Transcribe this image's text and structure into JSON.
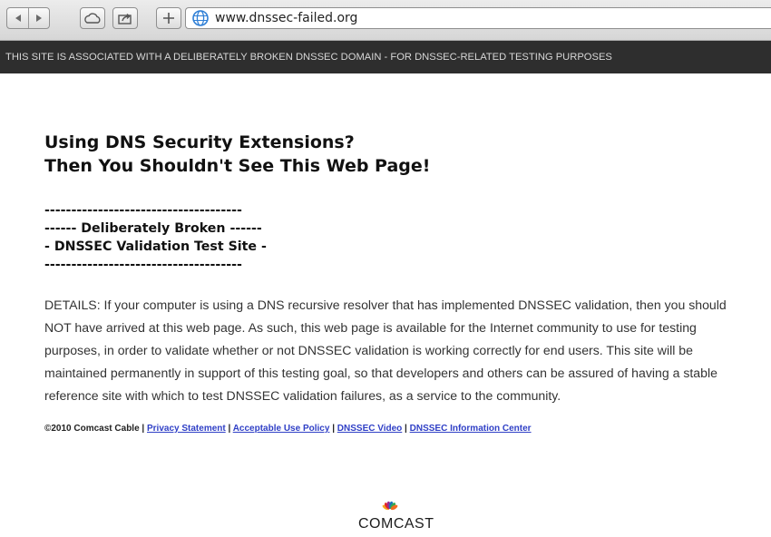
{
  "browser": {
    "url": "www.dnssec-failed.org",
    "icons": [
      "back-icon",
      "forward-icon",
      "cloud-icon",
      "share-icon",
      "add-tab-icon",
      "globe-icon"
    ]
  },
  "banner": {
    "text": "THIS SITE IS ASSOCIATED WITH A DELIBERATELY BROKEN DNSSEC DOMAIN - FOR DNSSEC-RELATED TESTING PURPOSES"
  },
  "page": {
    "heading_line1": "Using DNS Security Extensions?",
    "heading_line2": "Then You Shouldn't See This Web Page!",
    "sub_lines": [
      "-------------------------------------",
      "------ Deliberately Broken ------",
      "- DNSSEC Validation Test Site -",
      "-------------------------------------"
    ],
    "details": "DETAILS: If your computer is using a DNS recursive resolver that has implemented DNSSEC validation, then you should NOT have arrived at this web page. As such, this web page is available for the Internet community to use for testing purposes, in order to validate whether or not DNSSEC validation is working correctly for end users. This site will be maintained permanently in support of this testing goal, so that developers and others can be assured of having a stable reference site with which to test DNSSEC validation failures, as a service to the community."
  },
  "footer": {
    "copyright": "©2010 Comcast Cable",
    "separator": " | ",
    "links": [
      "Privacy Statement",
      "Acceptable Use Policy",
      "DNSSEC Video",
      "DNSSEC Information Center"
    ]
  },
  "logo": {
    "text": "COMCAST",
    "colors": [
      "#f5a623",
      "#e3262b",
      "#9b2a8e",
      "#1b75bc",
      "#33a853",
      "#f26b21"
    ]
  }
}
